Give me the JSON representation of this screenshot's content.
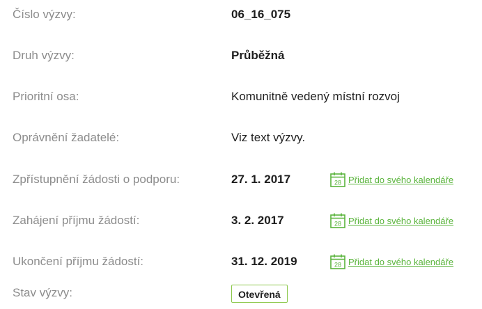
{
  "details": {
    "rows": [
      {
        "label": "Číslo výzvy:",
        "value": "06_16_075"
      },
      {
        "label": "Druh výzvy:",
        "value": "Průběžná"
      },
      {
        "label": "Prioritní osa:",
        "value": "Komunitně vedený místní rozvoj"
      },
      {
        "label": "Oprávnění žadatelé:",
        "value": "Viz text výzvy."
      },
      {
        "label": "Zpřístupnění žádosti o podporu:",
        "value": "27. 1. 2017",
        "calendar_link": "Přidat do svého kalendáře",
        "calendar_day": "28"
      },
      {
        "label": "Zahájení příjmu žádostí:",
        "value": "3. 2. 2017",
        "calendar_link": "Přidat do svého kalendáře",
        "calendar_day": "28"
      },
      {
        "label": "Ukončení příjmu žádostí:",
        "value": "31. 12. 2019",
        "calendar_link": "Přidat do svého kalendáře",
        "calendar_day": "28"
      },
      {
        "label": "Stav výzvy:",
        "value": "Otevřená"
      }
    ]
  },
  "colors": {
    "label": "#8c8c8c",
    "value": "#222222",
    "link": "#5ab43c",
    "badge_border": "#8cc84b"
  },
  "icons": {
    "calendar": "calendar-icon"
  }
}
